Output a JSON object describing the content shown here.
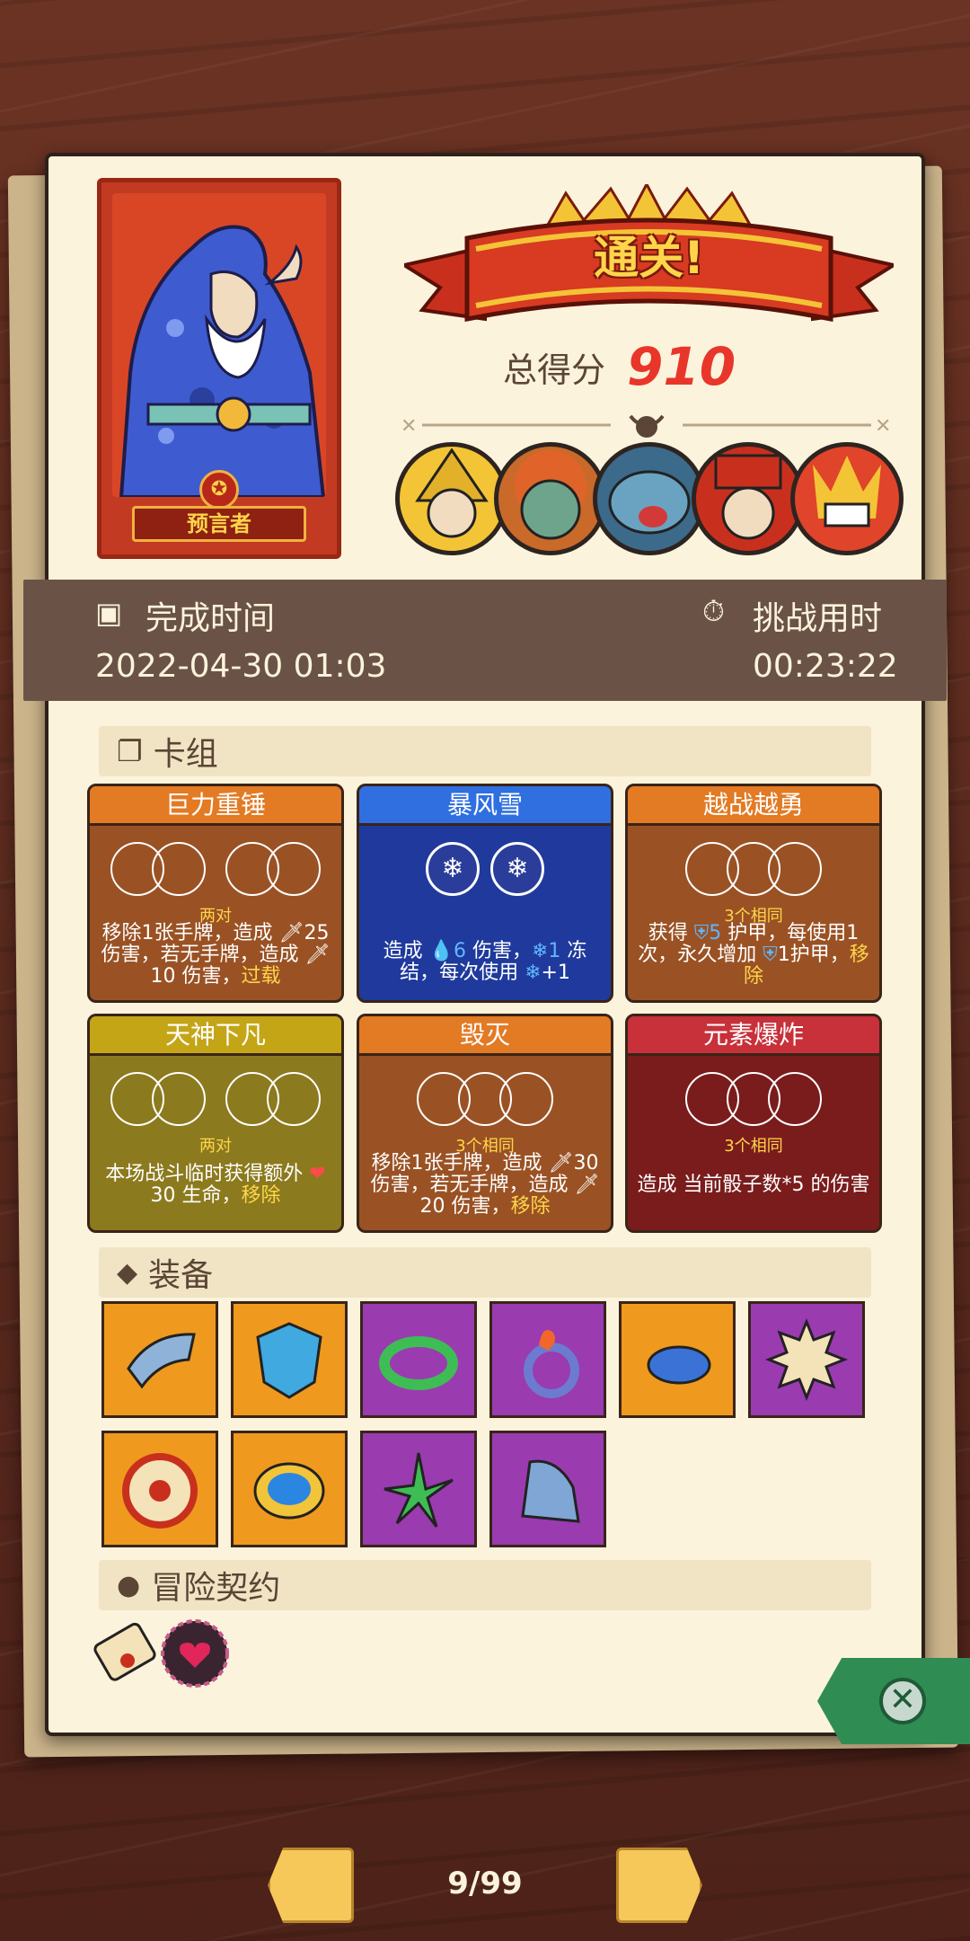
{
  "hero": {
    "name": "预言者"
  },
  "result": {
    "banner": "通关!",
    "score_label": "总得分",
    "score": "910"
  },
  "enemies": [
    "yellow-hat-wizard",
    "orange-haired-ogre",
    "blue-fish-monster",
    "red-hat-clown",
    "fire-demon"
  ],
  "time": {
    "complete_label": "完成时间",
    "complete_value": "2022-04-30 01:03",
    "challenge_label": "挑战用时",
    "challenge_value": "00:23:22"
  },
  "sections": {
    "deck": "卡组",
    "equipment": "装备",
    "pact": "冒险契约"
  },
  "cards": [
    {
      "title": "巨力重锤",
      "combo": "两对",
      "desc1": "移除1张手牌，造成 ",
      "dmg1": "25",
      "desc2": "伤害，若无手牌，造成 ",
      "dmg2": "10",
      "desc3": " 伤害，",
      "kw": "过载"
    },
    {
      "title": "暴风雪",
      "desc1": "造成 ",
      "water": "6",
      "desc2": " 伤害，",
      "snow": "1",
      "desc3": " 冻结，每次使用 ",
      "inc": "+1"
    },
    {
      "title": "越战越勇",
      "combo": "3个相同",
      "desc1": "获得 ",
      "armor": "5",
      "desc2": " 护甲，每使用1次，永久增加 ",
      "armor2": "1",
      "desc3": "护甲，",
      "kw": "移除"
    },
    {
      "title": "天神下凡",
      "combo": "两对",
      "desc1": "本场战斗临时获得额外 ",
      "heart": "❤",
      "desc2": "30 生命，",
      "kw": "移除"
    },
    {
      "title": "毁灭",
      "combo": "3个相同",
      "desc1": "移除1张手牌，造成 ",
      "dmg1": "30",
      "desc2": "伤害，若无手牌，造成 ",
      "dmg2": "20",
      "desc3": " 伤害，",
      "kw": "移除"
    },
    {
      "title": "元素爆炸",
      "combo": "3个相同",
      "desc1": "造成 当前骰子数*5 的伤害"
    }
  ],
  "equipment": [
    "horn",
    "blue-shield-crest",
    "green-spiked-bracelet",
    "fire-ring",
    "blue-blob",
    "spiked-dice",
    "round-shield",
    "blue-gem-brooch",
    "green-claw",
    "ice-bell"
  ],
  "pacts": [
    "scroll-icon",
    "heart-lock-icon"
  ],
  "pager": {
    "text": "9/99"
  },
  "colors": {
    "score": "#e8362a",
    "accent": "#ffd54a",
    "paper": "#fbf3dc"
  }
}
